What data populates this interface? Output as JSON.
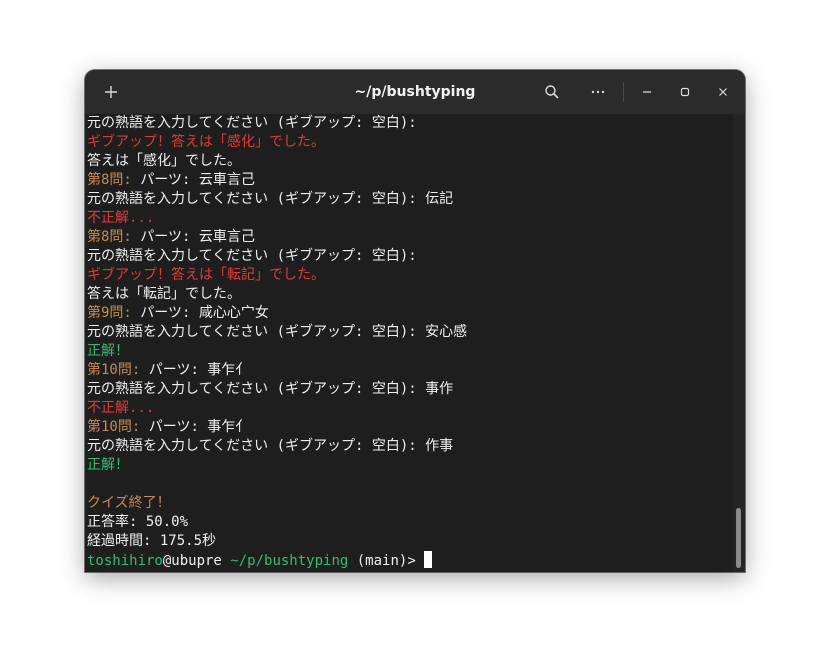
{
  "window": {
    "title": "~/p/bushtyping"
  },
  "titlebar": {
    "new_tab_icon": "plus-icon",
    "search_icon": "search-icon",
    "menu_icon": "more-horizontal-icon",
    "minimize_icon": "minimize-icon",
    "maximize_icon": "maximize-icon",
    "close_icon": "close-icon"
  },
  "colors": {
    "question_label": "#c88a4e",
    "error": "#e23a3a",
    "success": "#2fbf71",
    "text": "#f0f0f0",
    "background": "#1e1e1e"
  },
  "terminal": {
    "lines": [
      [
        {
          "t": "元の熟語を入力してください (ギブアップ: 空白):",
          "c": "white"
        }
      ],
      [
        {
          "t": "ギブアップ！答えは「感化」でした。",
          "c": "red"
        }
      ],
      [
        {
          "t": "答えは「感化」でした。",
          "c": "white"
        }
      ],
      [
        {
          "t": "第8問:",
          "c": "orange"
        },
        {
          "t": " パーツ: 云車言己",
          "c": "white"
        }
      ],
      [
        {
          "t": "元の熟語を入力してください (ギブアップ: 空白): 伝記",
          "c": "white"
        }
      ],
      [
        {
          "t": "不正解...",
          "c": "red"
        }
      ],
      [
        {
          "t": "第8問:",
          "c": "orange"
        },
        {
          "t": " パーツ: 云車言己",
          "c": "white"
        }
      ],
      [
        {
          "t": "元の熟語を入力してください (ギブアップ: 空白):",
          "c": "white"
        }
      ],
      [
        {
          "t": "ギブアップ！答えは「転記」でした。",
          "c": "red"
        }
      ],
      [
        {
          "t": "答えは「転記」でした。",
          "c": "white"
        }
      ],
      [
        {
          "t": "第9問:",
          "c": "orange"
        },
        {
          "t": " パーツ: 咸心心宀女",
          "c": "white"
        }
      ],
      [
        {
          "t": "元の熟語を入力してください (ギブアップ: 空白): 安心感",
          "c": "white"
        }
      ],
      [
        {
          "t": "正解！",
          "c": "green"
        }
      ],
      [
        {
          "t": "第10問:",
          "c": "orange"
        },
        {
          "t": " パーツ: 事乍亻",
          "c": "white"
        }
      ],
      [
        {
          "t": "元の熟語を入力してください (ギブアップ: 空白): 事作",
          "c": "white"
        }
      ],
      [
        {
          "t": "不正解...",
          "c": "red"
        }
      ],
      [
        {
          "t": "第10問:",
          "c": "orange"
        },
        {
          "t": " パーツ: 事乍亻",
          "c": "white"
        }
      ],
      [
        {
          "t": "元の熟語を入力してください (ギブアップ: 空白): 作事",
          "c": "white"
        }
      ],
      [
        {
          "t": "正解！",
          "c": "green"
        }
      ],
      [
        {
          "t": "",
          "c": "white"
        }
      ],
      [
        {
          "t": "クイズ終了！",
          "c": "orange"
        }
      ],
      [
        {
          "t": "正答率: 50.0%",
          "c": "white"
        }
      ],
      [
        {
          "t": "経過時間: 175.5秒",
          "c": "white"
        }
      ]
    ],
    "prompt": {
      "user": "toshihiro",
      "host": "@ubupre",
      "path": " ~/p/bushtyping",
      "branch": " (main)>",
      "input": " "
    }
  }
}
